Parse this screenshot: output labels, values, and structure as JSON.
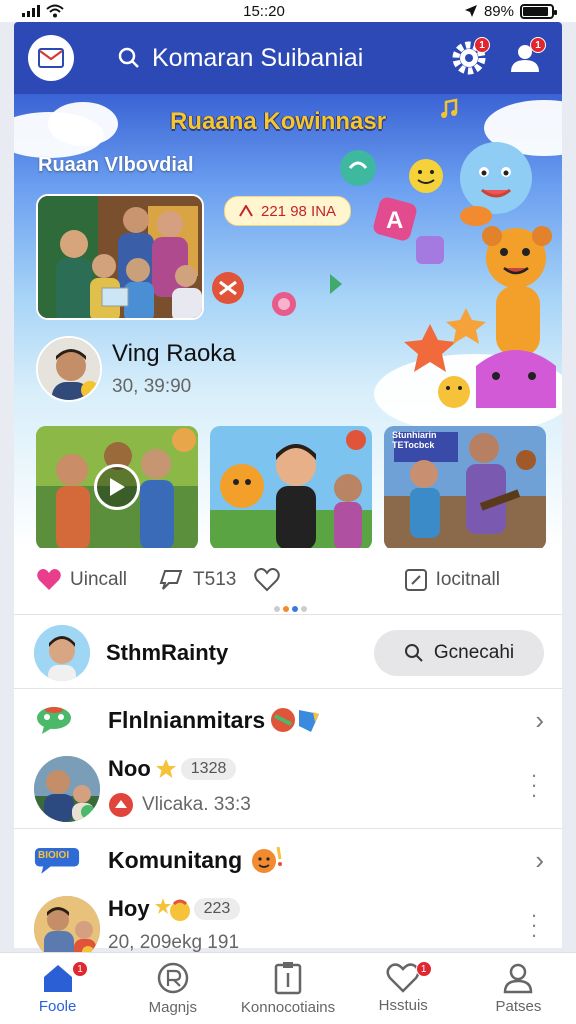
{
  "status_bar": {
    "time": "15::20",
    "battery": "89%",
    "battery_level": 0.89
  },
  "header": {
    "search_text": "Komaran Suibaniai",
    "settings_badge": "1",
    "profile_badge": "1"
  },
  "hero": {
    "title": "Ruaana Kowinnasr",
    "subtitle": "Ruaan Vlbovdial",
    "date_pill": "221 98 INA",
    "creator_name": "Ving Raoka",
    "creator_meta": "30, 39:90",
    "thumb3_caption": "Stunhiarin TETocbck"
  },
  "actions": {
    "like": "Uincall",
    "comment": "T513",
    "save": "Iocitnall"
  },
  "stream": {
    "label": "SthmRainty",
    "search_button": "Gcnecahi"
  },
  "sections": [
    {
      "title": "Flnlnianmitars",
      "entry_name": "Noo",
      "count": "1328",
      "sub": "Vlicaka. 33:3"
    },
    {
      "title": "Komunitang",
      "icon_text": "BIOIOI",
      "entry_name": "Hoy",
      "count": "223",
      "sub": "20, 209ekg 191"
    }
  ],
  "bottom_nav": [
    {
      "label": "Foole",
      "icon": "home-icon",
      "badge": "1"
    },
    {
      "label": "Magnjs",
      "icon": "circle-r-icon",
      "badge": ""
    },
    {
      "label": "Konnocotiains",
      "icon": "clipboard-icon",
      "badge": ""
    },
    {
      "label": "Hsstuis",
      "icon": "heart-icon",
      "badge": "1"
    },
    {
      "label": "Patses",
      "icon": "person-icon",
      "badge": ""
    }
  ],
  "colors": {
    "brand": "#2c49b6",
    "accent": "#2a5fd6",
    "badge": "#e0262e",
    "heart": "#e83e8c"
  }
}
